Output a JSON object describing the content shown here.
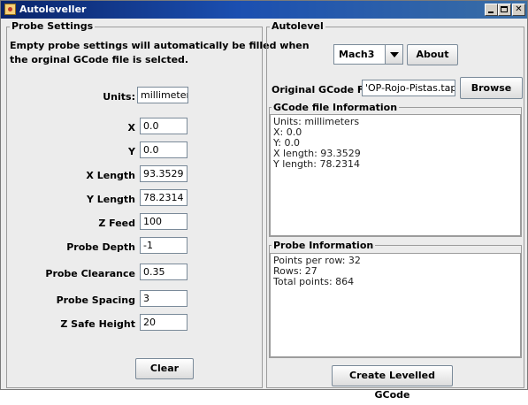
{
  "window": {
    "title": "Autoleveller"
  },
  "probe_settings": {
    "title": "Probe Settings",
    "note_line1": "Empty probe settings will automatically be filled when",
    "note_line2": "the orginal GCode file is selcted.",
    "fields": [
      {
        "label": "Units:",
        "value": "millimeters"
      },
      {
        "label": "X",
        "value": "0.0"
      },
      {
        "label": "Y",
        "value": "0.0"
      },
      {
        "label": "X Length",
        "value": "93.3529"
      },
      {
        "label": "Y Length",
        "value": "78.2314"
      },
      {
        "label": "Z Feed",
        "value": "100"
      },
      {
        "label": "Probe Depth",
        "value": "-1"
      },
      {
        "label": "Probe Clearance",
        "value": "0.35"
      },
      {
        "label": "Probe Spacing",
        "value": "3"
      },
      {
        "label": "Z Safe Height",
        "value": "20"
      }
    ],
    "clear_label": "Clear"
  },
  "autolevel": {
    "title": "Autolevel",
    "controller_selected": "Mach3",
    "about_label": "About",
    "original_file_label": "Original GCode File",
    "original_file_value": "'OP-Rojo-Pistas.tap",
    "browse_label": "Browse",
    "gcode_info": {
      "title": "GCode file Information",
      "lines": [
        "Units: millimeters",
        "X: 0.0",
        "Y: 0.0",
        "X length: 93.3529",
        "Y length: 78.2314"
      ]
    },
    "probe_info": {
      "title": "Probe Information",
      "lines": [
        "Points per row: 32",
        "Rows: 27",
        "Total points: 864"
      ]
    },
    "create_label": "Create Levelled GCode"
  }
}
